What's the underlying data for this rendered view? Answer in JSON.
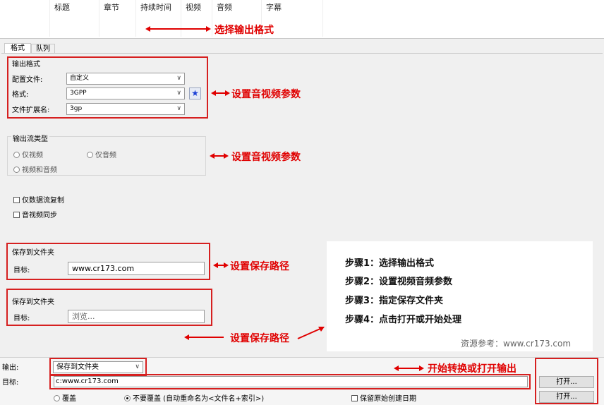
{
  "table": {
    "columns": [
      "标题",
      "章节",
      "持续时间",
      "视频",
      "音频",
      "字幕"
    ]
  },
  "annotations": {
    "select_format": "选择输出格式",
    "av_params_1": "设置音视频参数",
    "av_params_2": "设置音视频参数",
    "save_path_1": "设置保存路径",
    "save_path_2": "设置保存路径",
    "start": "开始转换或打开输出"
  },
  "tabs": [
    "格式",
    "队列"
  ],
  "output_format": {
    "title": "输出格式",
    "profile_label": "配置文件:",
    "profile_value": "自定义",
    "format_label": "格式:",
    "format_value": "3GPP",
    "ext_label": "文件扩展名:",
    "ext_value": "3gp"
  },
  "stream_type": {
    "title": "输出流类型",
    "video_only": "仅视频",
    "audio_only": "仅音频",
    "video_audio": "视频和音频"
  },
  "options": {
    "copy_stream": "仅数据流复制",
    "av_sync": "音视频同步"
  },
  "save_folder_1": {
    "title": "保存到文件夹",
    "target_label": "目标:",
    "target_value": "www.cr173.com"
  },
  "save_folder_2": {
    "title": "保存到文件夹",
    "target_label": "目标:",
    "target_value": "浏览..."
  },
  "steps": {
    "s1": "步骤1：选择输出格式",
    "s2": "步骤2：设置视频音频参数",
    "s3": "步骤3：指定保存文件夹",
    "s4": "步骤4：点击打开或开始处理",
    "source": "资源参考：www.cr173.com"
  },
  "bottom": {
    "output_label": "输出:",
    "output_value": "保存到文件夹",
    "target_label": "目标:",
    "target_value": "c:www.cr173.com",
    "open_btn_1": "打开...",
    "open_btn_2": "打开...",
    "overwrite": "覆盖",
    "no_overwrite": "不要覆盖 (自动重命名为<文件名+索引>)",
    "keep_date": "保留原始创建日期"
  },
  "colors": {
    "annotation": "#e00000",
    "star": "#1a3fd6"
  }
}
